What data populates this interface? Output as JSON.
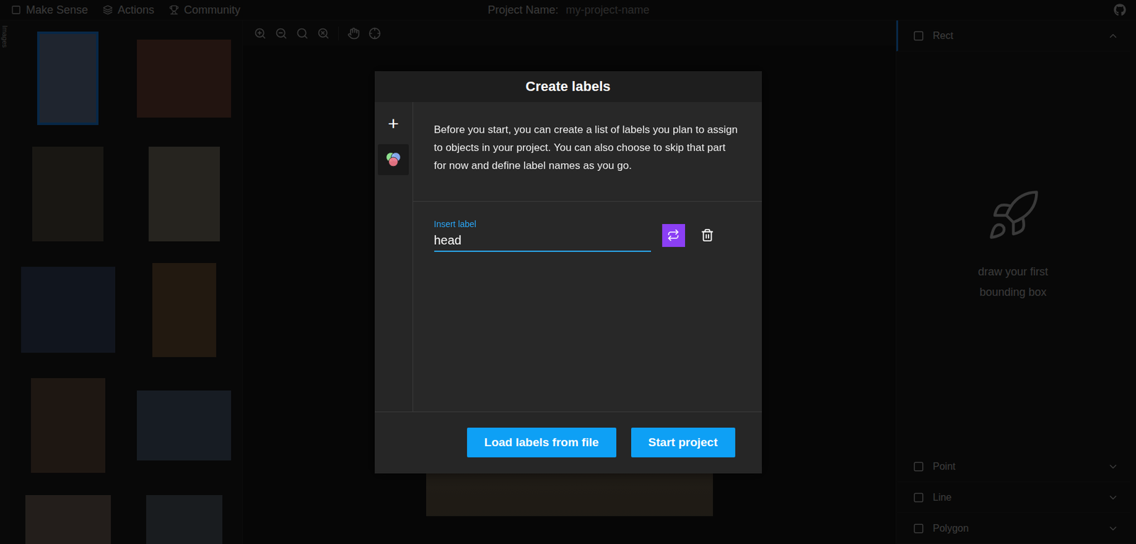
{
  "topbar": {
    "brand": "Make Sense",
    "menu": [
      {
        "label": "Actions"
      },
      {
        "label": "Community"
      }
    ],
    "project_label": "Project Name:",
    "project_name": "my-project-name"
  },
  "sidebar": {
    "tab": "Images",
    "images": [
      {
        "selected": true
      },
      {
        "selected": false
      },
      {
        "selected": false
      },
      {
        "selected": false
      },
      {
        "selected": false
      },
      {
        "selected": false
      },
      {
        "selected": false
      },
      {
        "selected": false
      },
      {
        "selected": false
      },
      {
        "selected": false
      }
    ]
  },
  "right_panel": {
    "sections": [
      {
        "label": "Rect",
        "expanded": true,
        "selected": true
      },
      {
        "label": "Point",
        "expanded": false,
        "selected": false
      },
      {
        "label": "Line",
        "expanded": false,
        "selected": false
      },
      {
        "label": "Polygon",
        "expanded": false,
        "selected": false
      }
    ],
    "empty_message": "draw your first bounding box"
  },
  "dialog": {
    "title": "Create labels",
    "add_glyph": "+",
    "description": "Before you start, you can create a list of labels you plan to assign to objects in your project. You can also choose to skip that part for now and define label names as you go.",
    "labels": [
      {
        "caption": "Insert label",
        "value": "head",
        "focused": true,
        "color": "#8b3ff5"
      }
    ],
    "buttons": [
      {
        "label": "Load labels from file"
      },
      {
        "label": "Start project"
      }
    ]
  }
}
